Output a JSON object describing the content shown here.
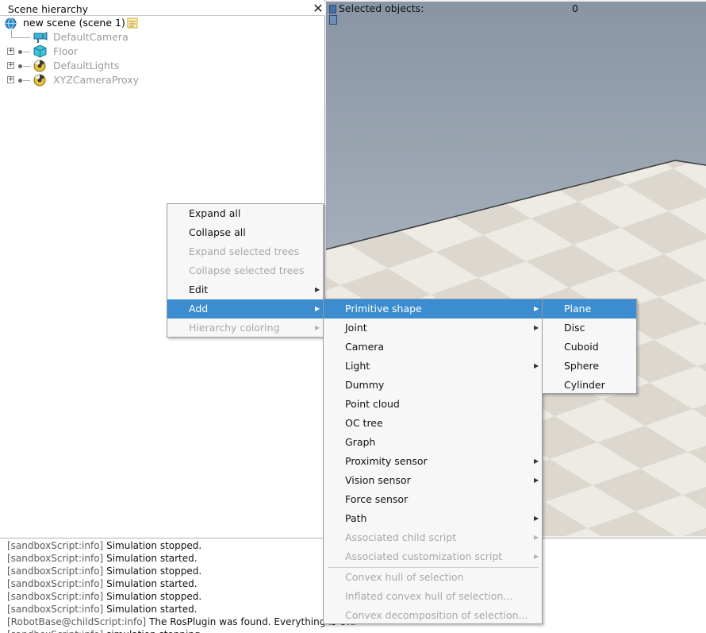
{
  "hierarchy": {
    "title": "Scene hierarchy",
    "close_symbol": "✕",
    "scene": "new scene (scene 1)",
    "items": [
      {
        "label": "DefaultCamera",
        "icon": "camera-icon"
      },
      {
        "label": "Floor",
        "icon": "cube-icon"
      },
      {
        "label": "DefaultLights",
        "icon": "light-icon"
      },
      {
        "label": "XYZCameraProxy",
        "icon": "proxy-icon"
      }
    ]
  },
  "viewport": {
    "selected_label": "Selected objects:",
    "selected_count": "0"
  },
  "context_menu": {
    "items": [
      {
        "label": "Expand all",
        "disabled": false,
        "submenu": false
      },
      {
        "label": "Collapse all",
        "disabled": false,
        "submenu": false
      },
      {
        "label": "Expand selected trees",
        "disabled": true,
        "submenu": false
      },
      {
        "label": "Collapse selected trees",
        "disabled": true,
        "submenu": false
      },
      {
        "label": "Edit",
        "disabled": false,
        "submenu": true
      },
      {
        "label": "Add",
        "disabled": false,
        "submenu": true
      },
      {
        "label": "Hierarchy coloring",
        "disabled": true,
        "submenu": true
      }
    ]
  },
  "add_menu": {
    "items": [
      {
        "label": "Primitive shape",
        "disabled": false,
        "submenu": true
      },
      {
        "label": "Joint",
        "disabled": false,
        "submenu": true
      },
      {
        "label": "Camera",
        "disabled": false,
        "submenu": false
      },
      {
        "label": "Light",
        "disabled": false,
        "submenu": true
      },
      {
        "label": "Dummy",
        "disabled": false,
        "submenu": false
      },
      {
        "label": "Point cloud",
        "disabled": false,
        "submenu": false
      },
      {
        "label": "OC tree",
        "disabled": false,
        "submenu": false
      },
      {
        "label": "Graph",
        "disabled": false,
        "submenu": false
      },
      {
        "label": "Proximity sensor",
        "disabled": false,
        "submenu": true
      },
      {
        "label": "Vision sensor",
        "disabled": false,
        "submenu": true
      },
      {
        "label": "Force sensor",
        "disabled": false,
        "submenu": false
      },
      {
        "label": "Path",
        "disabled": false,
        "submenu": true
      },
      {
        "label": "Associated child script",
        "disabled": true,
        "submenu": true
      },
      {
        "label": "Associated customization script",
        "disabled": true,
        "submenu": true
      },
      {
        "label": "Convex hull of selection",
        "disabled": true,
        "submenu": false
      },
      {
        "label": "Inflated convex hull of selection...",
        "disabled": true,
        "submenu": false
      },
      {
        "label": "Convex decomposition of selection...",
        "disabled": true,
        "submenu": false
      }
    ]
  },
  "primitive_menu": {
    "items": [
      "Plane",
      "Disc",
      "Cuboid",
      "Sphere",
      "Cylinder"
    ]
  },
  "console": {
    "lines": [
      {
        "tag": "[sandboxScript:info]",
        "text": "Simulation stopped."
      },
      {
        "tag": "[sandboxScript:info]",
        "text": "Simulation started."
      },
      {
        "tag": "[sandboxScript:info]",
        "text": "Simulation stopped."
      },
      {
        "tag": "[sandboxScript:info]",
        "text": "Simulation started."
      },
      {
        "tag": "[sandboxScript:info]",
        "text": "Simulation stopped."
      },
      {
        "tag": "[sandboxScript:info]",
        "text": "Simulation started."
      },
      {
        "tag": "[RobotBase@childScript:info]",
        "text": "The RosPlugin was found. Everything is OK."
      },
      {
        "tag": "[sandboxScript:info]",
        "text": "simulation stopping..."
      }
    ]
  },
  "colors": {
    "highlight": "#3b8dd0",
    "sky_top": "#8a97a6",
    "sky_bottom": "#c3c9d1"
  }
}
